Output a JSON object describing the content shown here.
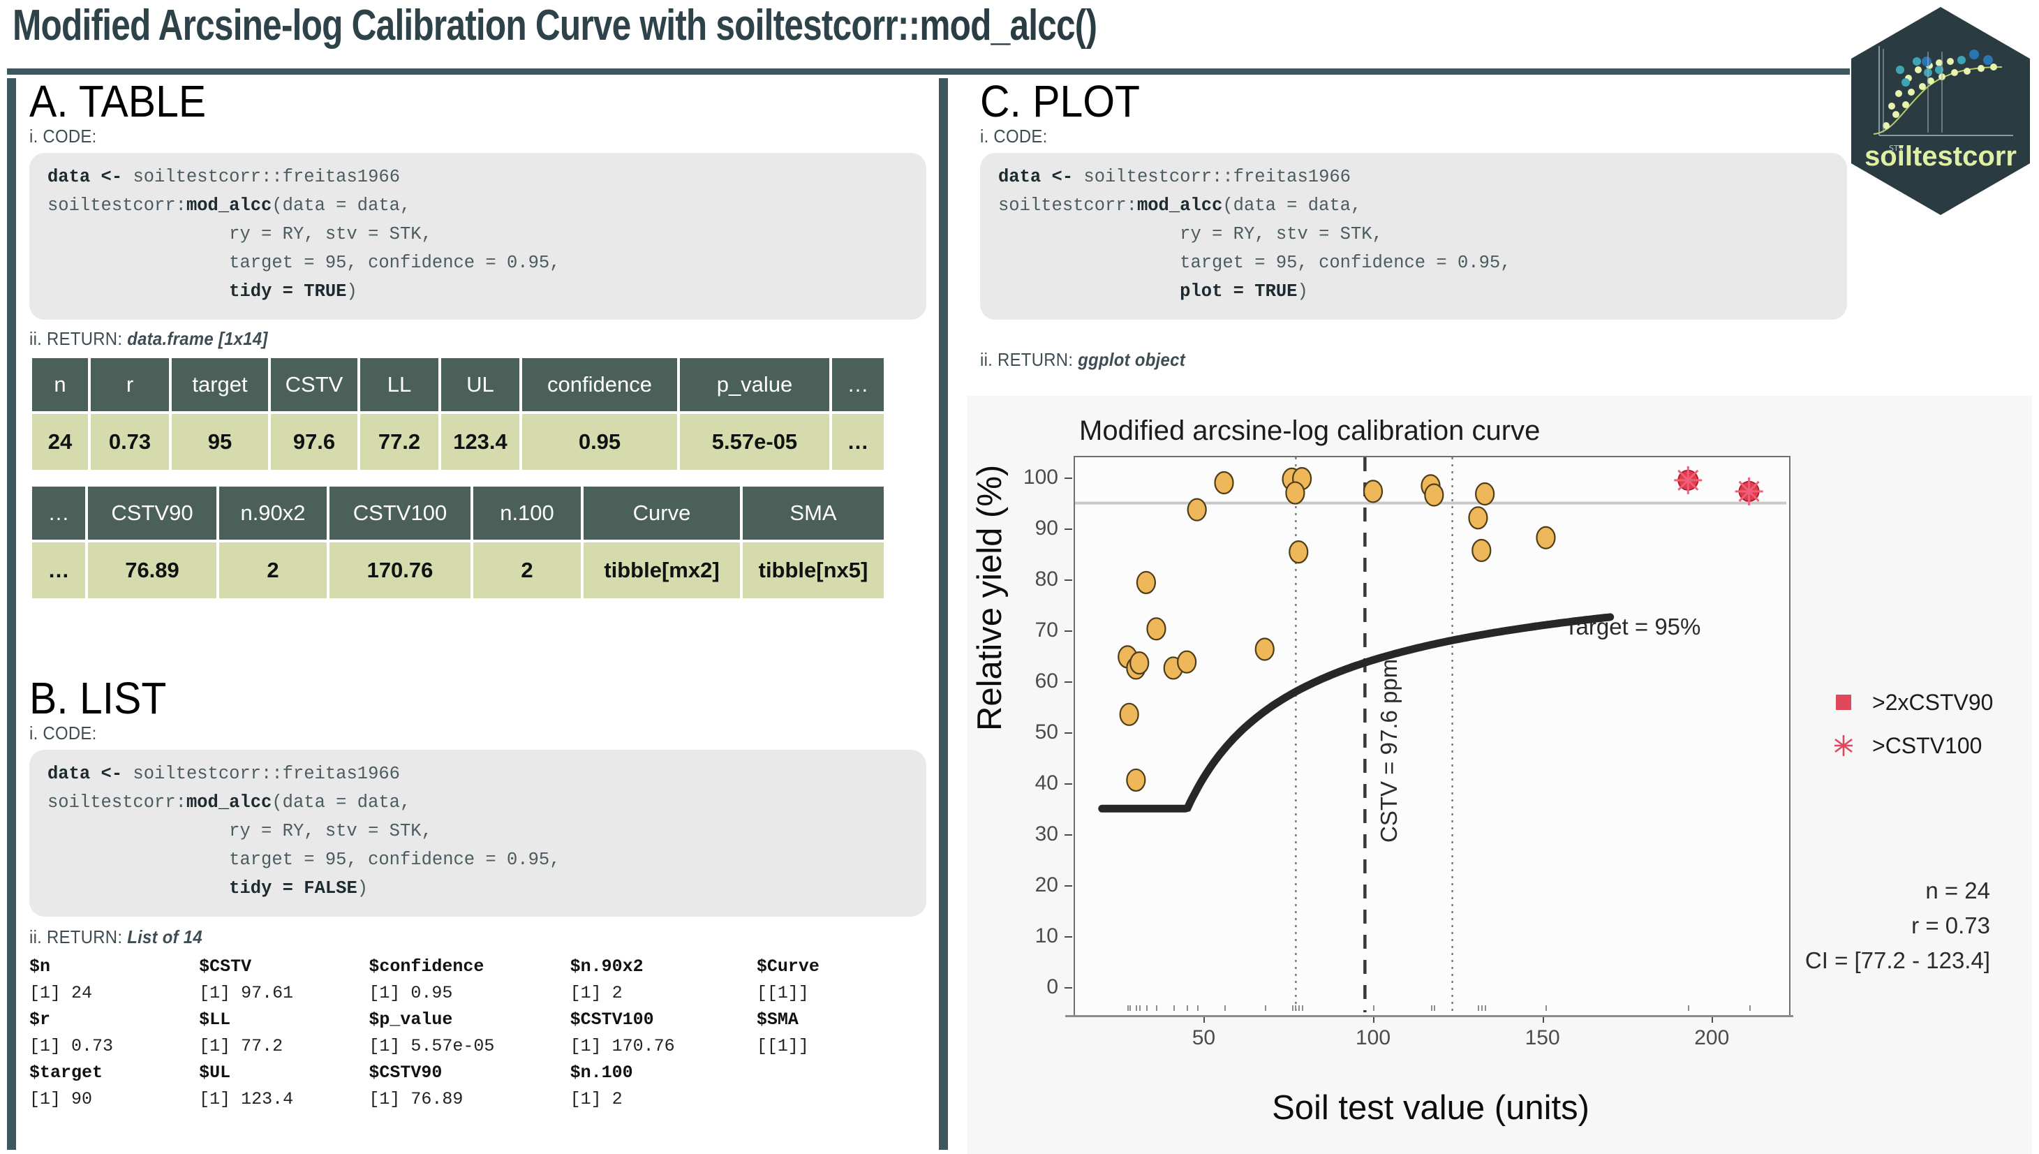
{
  "poster": {
    "title_prefix": "Modified Arcsine-log Calibration Curve with soiltestcorr::",
    "title_fn": "mod_alcc()",
    "logo_text": "soiltestcorr",
    "accent_dark": "#3e565e",
    "table_header_bg": "#4b6059",
    "table_cell_bg": "#d6dbae"
  },
  "sections": {
    "a": {
      "title": "A. TABLE",
      "code_label": "i. CODE:",
      "return_label": "ii. RETURN:",
      "return_value": "data.frame [1x14]",
      "code_lines": [
        "data <- soiltestcorr::freitas1966",
        "soiltestcorr:mod_alcc(data = data,",
        "                 ry = RY, stv = STK,",
        "                 target = 95, confidence = 0.95,",
        "                 tidy = TRUE)"
      ],
      "table1_headers": [
        "n",
        "r",
        "target",
        "CSTV",
        "LL",
        "UL",
        "confidence",
        "p_value",
        "…"
      ],
      "table1_values": [
        "24",
        "0.73",
        "95",
        "97.6",
        "77.2",
        "123.4",
        "0.95",
        "5.57e-05",
        "…"
      ],
      "table2_headers": [
        "…",
        "CSTV90",
        "n.90x2",
        "CSTV100",
        "n.100",
        "Curve",
        "SMA"
      ],
      "table2_values": [
        "…",
        "76.89",
        "2",
        "170.76",
        "2",
        "tibble[mx2]",
        "tibble[nx5]"
      ]
    },
    "b": {
      "title": "B. LIST",
      "code_label": "i. CODE:",
      "return_label": "ii. RETURN:",
      "return_value": "List of 14",
      "code_lines": [
        "data <- soiltestcorr::freitas1966",
        "soiltestcorr:mod_alcc(data = data,",
        "                 ry = RY, stv = STK,",
        "                 target = 95, confidence = 0.95,",
        "                 tidy = FALSE)"
      ],
      "list_columns": [
        [
          {
            "key": "$n",
            "val": "[1] 24"
          },
          {
            "key": "$r",
            "val": "[1] 0.73"
          },
          {
            "key": "$target",
            "val": "[1] 90"
          }
        ],
        [
          {
            "key": "$CSTV",
            "val": "[1] 97.61"
          },
          {
            "key": "$LL",
            "val": "[1] 77.2"
          },
          {
            "key": "$UL",
            "val": "[1] 123.4"
          }
        ],
        [
          {
            "key": "$confidence",
            "val": "[1] 0.95"
          },
          {
            "key": "$p_value",
            "val": "[1] 5.57e-05"
          },
          {
            "key": "$CSTV90",
            "val": "[1] 76.89"
          }
        ],
        [
          {
            "key": "$n.90x2",
            "val": "[1] 2"
          },
          {
            "key": "$CSTV100",
            "val": "[1] 170.76"
          },
          {
            "key": "$n.100",
            "val": "[1] 2"
          }
        ],
        [
          {
            "key": "$Curve",
            "val": "[[1]]"
          },
          {
            "key": "$SMA",
            "val": "[[1]]"
          }
        ]
      ]
    },
    "c": {
      "title": "C. PLOT",
      "code_label": "i. CODE:",
      "return_label": "ii. RETURN:",
      "return_value": "ggplot object",
      "code_lines": [
        "data <- soiltestcorr::freitas1966",
        "soiltestcorr:mod_alcc(data = data,",
        "                 ry = RY, stv = STK,",
        "                 target = 95, confidence = 0.95,",
        "                 plot = TRUE)"
      ]
    }
  },
  "chart_data": {
    "type": "scatter",
    "title": "Modified arcsine-log calibration curve",
    "xlabel": "Soil test value (units)",
    "ylabel": "Relative yield (%)",
    "xlim": [
      12,
      222
    ],
    "ylim": [
      -5,
      104
    ],
    "xticks": [
      50,
      100,
      150,
      200
    ],
    "yticks": [
      0,
      10,
      20,
      30,
      40,
      50,
      60,
      70,
      80,
      90,
      100
    ],
    "grid": false,
    "legend_position": "right",
    "point_color": "#edb75a",
    "outlier_color": "#e0485e",
    "curve_color": "#272727",
    "points": [
      {
        "x": 30,
        "y": 40.6
      },
      {
        "x": 28,
        "y": 53.5
      },
      {
        "x": 27.5,
        "y": 64.8
      },
      {
        "x": 30,
        "y": 62.6
      },
      {
        "x": 31,
        "y": 63.6
      },
      {
        "x": 41,
        "y": 62.6
      },
      {
        "x": 45,
        "y": 63.8
      },
      {
        "x": 36,
        "y": 70.3
      },
      {
        "x": 68,
        "y": 66.3
      },
      {
        "x": 33,
        "y": 79.4
      },
      {
        "x": 78,
        "y": 85.4
      },
      {
        "x": 132,
        "y": 85.7
      },
      {
        "x": 131,
        "y": 92.1
      },
      {
        "x": 151,
        "y": 88.2
      },
      {
        "x": 48,
        "y": 93.7
      },
      {
        "x": 56,
        "y": 99.0
      },
      {
        "x": 76,
        "y": 99.7
      },
      {
        "x": 79,
        "y": 99.8
      },
      {
        "x": 77,
        "y": 97.0
      },
      {
        "x": 100,
        "y": 97.3
      },
      {
        "x": 117,
        "y": 98.4
      },
      {
        "x": 118,
        "y": 96.6
      },
      {
        "x": 133,
        "y": 96.8
      },
      {
        "x": 193,
        "y": 99.5
      },
      {
        "x": 211,
        "y": 97.3
      }
    ],
    "outliers": [
      {
        "x": 193,
        "y": 99.5,
        "marker": "square-star"
      },
      {
        "x": 211,
        "y": 97.3,
        "marker": "square-star"
      }
    ],
    "hline": {
      "y": 95,
      "label": "Target = 95%"
    },
    "vline_dashed": {
      "x": 97.6,
      "label": "CSTV = 97.6 ppm"
    },
    "vlines_dotted": [
      77.2,
      123.4
    ],
    "legend": [
      {
        "label": ">2xCSTV90",
        "marker": "square"
      },
      {
        "label": ">CSTV100",
        "marker": "asterisk"
      }
    ],
    "annotations": {
      "target": "Target = 95%",
      "cstv": "CSTV = 97.6 ppm",
      "n": "n = 24",
      "r": "r = 0.73",
      "ci": "CI = [77.2 - 123.4]"
    }
  }
}
